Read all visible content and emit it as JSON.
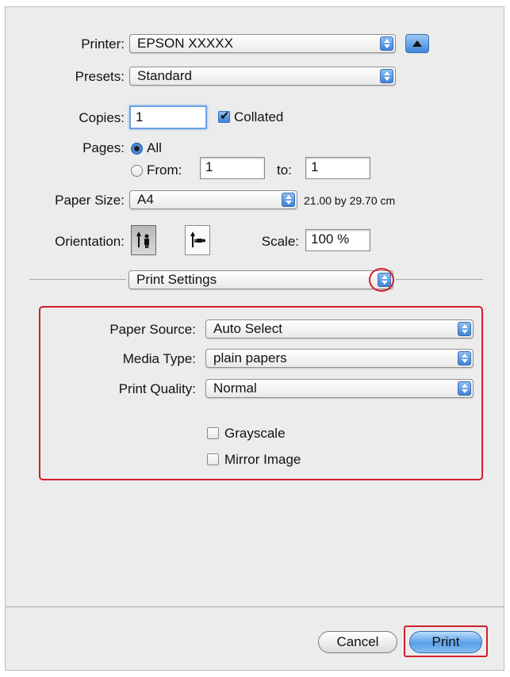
{
  "printer": {
    "label": "Printer:",
    "value": "EPSON XXXXX"
  },
  "presets": {
    "label": "Presets:",
    "value": "Standard"
  },
  "copies": {
    "label": "Copies:",
    "value": "1",
    "collated_label": "Collated",
    "collated": true
  },
  "pages": {
    "label": "Pages:",
    "all_label": "All",
    "from_label": "From:",
    "from_value": "1",
    "to_label": "to:",
    "to_value": "1"
  },
  "paper_size": {
    "label": "Paper Size:",
    "value": "A4",
    "dimensions": "21.00 by 29.70 cm"
  },
  "orientation": {
    "label": "Orientation:"
  },
  "scale": {
    "label": "Scale:",
    "value": "100 %"
  },
  "section": {
    "value": "Print Settings"
  },
  "print_settings": {
    "paper_source": {
      "label": "Paper Source:",
      "value": "Auto Select"
    },
    "media_type": {
      "label": "Media Type:",
      "value": "plain papers"
    },
    "print_quality": {
      "label": "Print Quality:",
      "value": "Normal"
    },
    "grayscale_label": "Grayscale",
    "mirror_label": "Mirror Image"
  },
  "buttons": {
    "cancel": "Cancel",
    "print": "Print"
  },
  "colors": {
    "highlight": "#d21f2b",
    "accent": "#3d82d8"
  }
}
